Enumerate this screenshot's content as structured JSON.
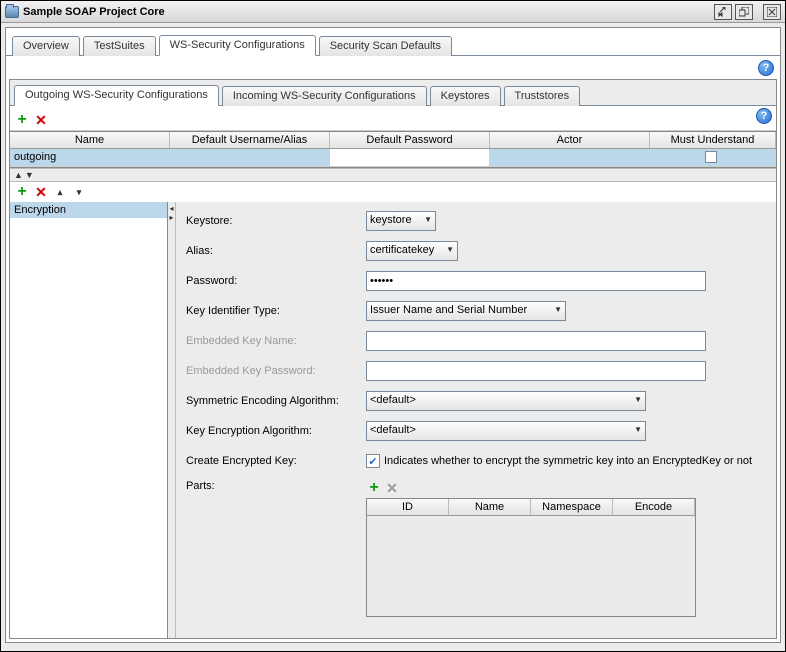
{
  "window": {
    "title": "Sample SOAP Project Core"
  },
  "mainTabs": [
    "Overview",
    "TestSuites",
    "WS-Security Configurations",
    "Security Scan Defaults"
  ],
  "mainActiveIndex": 2,
  "subTabs": [
    "Outgoing WS-Security Configurations",
    "Incoming WS-Security Configurations",
    "Keystores",
    "Truststores"
  ],
  "subActiveIndex": 0,
  "outgoingTable": {
    "columns": [
      "Name",
      "Default Username/Alias",
      "Default Password",
      "Actor",
      "Must Understand"
    ],
    "rows": [
      {
        "name": "outgoing",
        "alias": "",
        "password": "",
        "actor": "",
        "mustUnderstand": false,
        "selected": true
      }
    ]
  },
  "wssEntries": [
    {
      "label": "Encryption",
      "selected": true
    }
  ],
  "form": {
    "keystore": {
      "label": "Keystore:",
      "value": "keystore"
    },
    "alias": {
      "label": "Alias:",
      "value": "certificatekey"
    },
    "password": {
      "label": "Password:",
      "value": "••••••"
    },
    "keyIdType": {
      "label": "Key Identifier Type:",
      "value": "Issuer Name and Serial Number"
    },
    "embeddedKeyName": {
      "label": "Embedded Key Name:",
      "value": "",
      "disabled": true
    },
    "embeddedKeyPassword": {
      "label": "Embedded Key Password:",
      "value": "",
      "disabled": true
    },
    "symEncAlg": {
      "label": "Symmetric Encoding Algorithm:",
      "value": "<default>"
    },
    "keyEncAlg": {
      "label": "Key Encryption Algorithm:",
      "value": "<default>"
    },
    "createEncKey": {
      "label": "Create Encrypted Key:",
      "checked": true,
      "hint": "Indicates whether to encrypt the symmetric key into an EncryptedKey or not"
    },
    "parts": {
      "label": "Parts:",
      "columns": [
        "ID",
        "Name",
        "Namespace",
        "Encode"
      ]
    }
  },
  "help": "?"
}
